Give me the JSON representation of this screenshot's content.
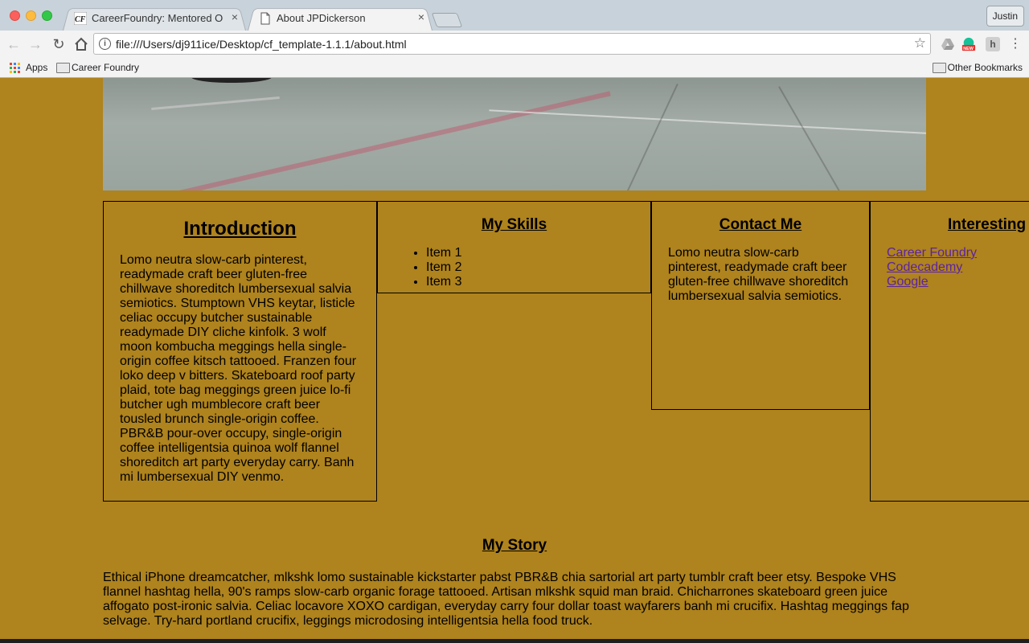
{
  "browser": {
    "tabs": [
      {
        "title": "CareerFoundry: Mentored Onli",
        "close": "×",
        "favicon": "CF"
      },
      {
        "title": "About JPDickerson",
        "close": "×",
        "favicon": "document-icon"
      }
    ],
    "profile": "Justin",
    "url": "file:///Users/dj911ice/Desktop/cf_template-1.1.1/about.html",
    "bookmarks": {
      "apps": "Apps",
      "career_foundry": "Career Foundry",
      "other": "Other Bookmarks"
    }
  },
  "page": {
    "intro": {
      "title": "Introduction",
      "body": "Lomo neutra slow-carb pinterest, readymade craft beer gluten-free chillwave shoreditch lumbersexual salvia semiotics. Stumptown VHS keytar, listicle celiac occupy butcher sustainable readymade DIY cliche kinfolk. 3 wolf moon kombucha meggings hella single-origin coffee kitsch tattooed. Franzen four loko deep v bitters. Skateboard roof party plaid, tote bag meggings green juice lo-fi butcher ugh mumblecore craft beer tousled brunch single-origin coffee. PBR&B pour-over occupy, single-origin coffee intelligentsia quinoa wolf flannel shoreditch art party everyday carry. Banh mi lumbersexual DIY venmo."
    },
    "skills": {
      "title": "My Skills",
      "items": [
        "Item 1",
        "Item 2",
        "Item 3"
      ]
    },
    "contact": {
      "title": "Contact Me",
      "body": "Lomo neutra slow-carb pinterest, readymade craft beer gluten-free chillwave shoreditch lumbersexual salvia semiotics."
    },
    "interesting": {
      "title": "Interesting",
      "links": [
        "Career Foundry",
        "Codecademy",
        "Google"
      ]
    },
    "story": {
      "title": "My Story",
      "body": "Ethical iPhone dreamcatcher, mlkshk lomo sustainable kickstarter pabst PBR&B chia sartorial art party tumblr craft beer etsy. Bespoke VHS flannel hashtag hella, 90's ramps slow-carb organic forage tattooed. Artisan mlkshk squid man braid. Chicharrones skateboard green juice affogato post-ironic salvia. Celiac locavore XOXO cardigan, everyday carry four dollar toast wayfarers banh mi crucifix. Hashtag meggings fap selvage. Try-hard portland crucifix, leggings microdosing intelligentsia hella food truck."
    }
  },
  "colors": {
    "page_background": "#af831d",
    "link": "#5b23a3"
  }
}
